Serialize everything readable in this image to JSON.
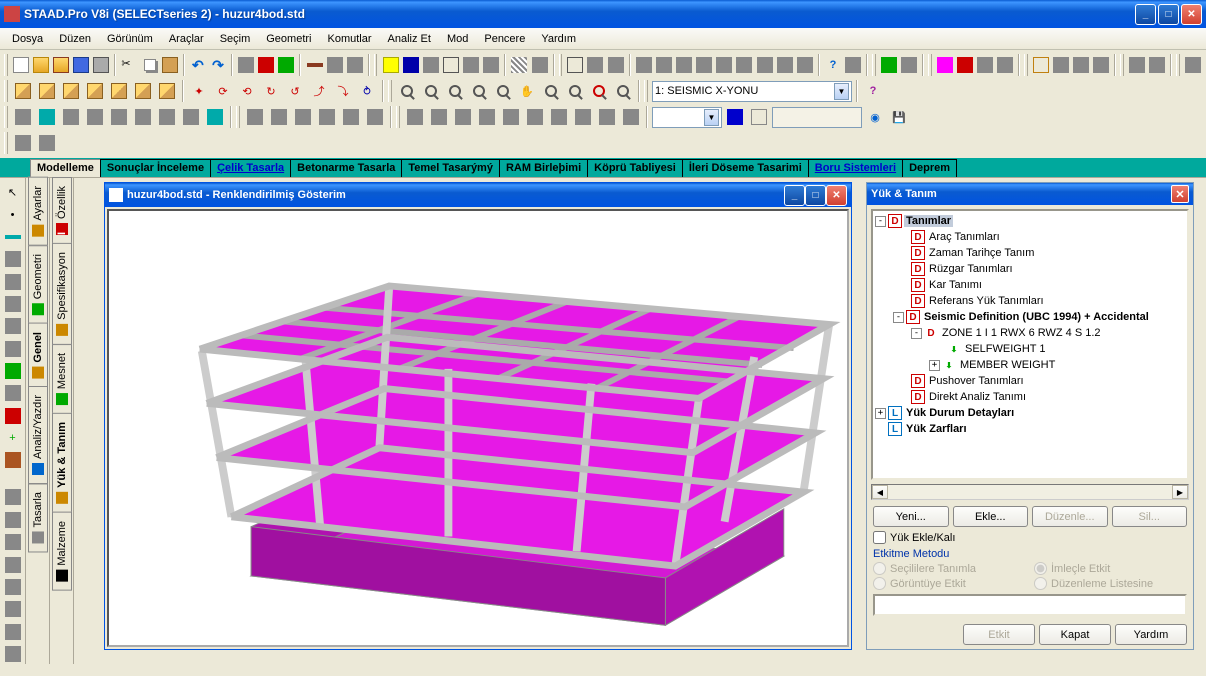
{
  "title": "STAAD.Pro V8i (SELECTseries 2) - huzur4bod.std",
  "menu": [
    "Dosya",
    "Düzen",
    "Görünüm",
    "Araçlar",
    "Seçim",
    "Geometri",
    "Komutlar",
    "Analiz Et",
    "Mod",
    "Pencere",
    "Yardım"
  ],
  "load_combo": "1: SEISMIC X-YONU",
  "main_tabs": [
    {
      "label": "Modelleme",
      "active": true
    },
    {
      "label": "Sonuçlar İnceleme"
    },
    {
      "label": "Çelik Tasarla",
      "link": true
    },
    {
      "label": "Betonarme Tasarla"
    },
    {
      "label": "Temel Tasarýmý"
    },
    {
      "label": "RAM Birleþimi"
    },
    {
      "label": "Köprü Tabliyesi"
    },
    {
      "label": "İleri Döseme Tasarimi"
    },
    {
      "label": "Boru Sistemleri",
      "link": true
    },
    {
      "label": "Deprem"
    }
  ],
  "vtabs_left": [
    "Tasarla",
    "Analiz/Yazdır",
    "Genel",
    "Geometri",
    "Ayarlar"
  ],
  "vtabs_right": [
    "Malzeme",
    "Yük & Tanım",
    "Mesnet",
    "Spesifikasyon",
    "Özellik"
  ],
  "doc_window_title": "huzur4bod.std - Renklendirilmiş Gösterim",
  "side_panel": {
    "title": "Yük & Tanım",
    "tree": {
      "root": "Tanımlar",
      "items": [
        "Araç Tanımları",
        "Zaman Tarihçe Tanım",
        "Rüzgar Tanımları",
        "Kar Tanımı",
        "Referans Yük Tanımları"
      ],
      "seismic": {
        "label": "Seismic Definition (UBC 1994) + Accidental",
        "zone": "ZONE 1 I 1 RWX 6 RWZ 4 S 1.2",
        "sub1": "SELFWEIGHT 1",
        "sub2": "MEMBER WEIGHT"
      },
      "after": [
        "Pushover Tanımları",
        "Direkt Analiz Tanımı"
      ],
      "load_details": "Yük Durum Detayları",
      "load_env": "Yük Zarfları"
    },
    "buttons": {
      "new": "Yeni...",
      "add": "Ekle...",
      "edit": "Düzenle...",
      "del": "Sil..."
    },
    "checkbox": "Yük Ekle/Kalı",
    "section": "Etkitme Metodu",
    "radios": [
      "Seçililere Tanımla",
      "İmleçle Etkit",
      "Görüntüye Etkit",
      "Düzenleme Listesine"
    ],
    "bottom_buttons": {
      "assign": "Etkit",
      "close": "Kapat",
      "help": "Yardım"
    }
  }
}
